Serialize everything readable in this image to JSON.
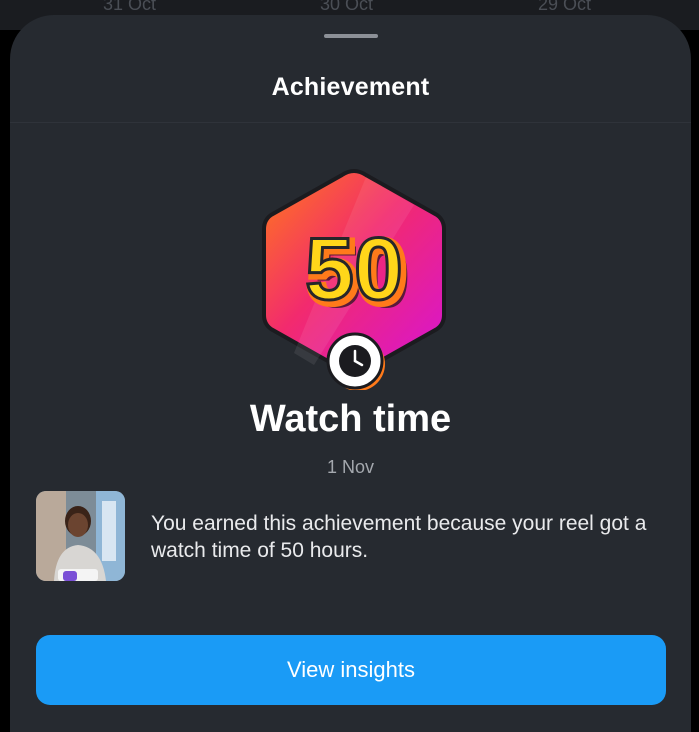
{
  "background": {
    "dates": [
      "31 Oct",
      "30 Oct",
      "29 Oct"
    ]
  },
  "sheet": {
    "title": "Achievement",
    "badge": {
      "number": "50",
      "icon": "clock-icon",
      "gradient": [
        "#ff7a1a",
        "#f02a7a",
        "#e217c8"
      ]
    },
    "achievement_name": "Watch time",
    "date": "1 Nov",
    "description": "You earned this achievement because your reel got a watch time of 50 hours.",
    "cta_label": "View insights",
    "accent_color": "#1a9bf6"
  }
}
